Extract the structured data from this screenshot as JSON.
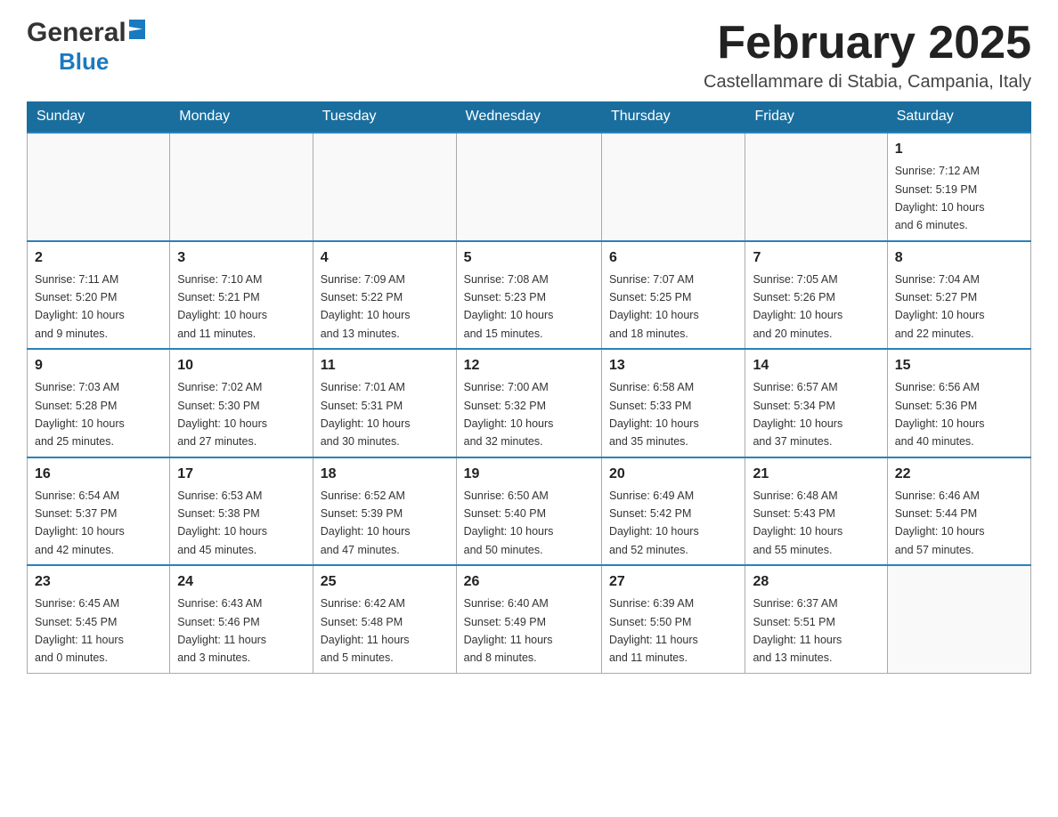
{
  "logo": {
    "general": "General",
    "blue": "Blue"
  },
  "header": {
    "month": "February 2025",
    "location": "Castellammare di Stabia, Campania, Italy"
  },
  "weekdays": [
    "Sunday",
    "Monday",
    "Tuesday",
    "Wednesday",
    "Thursday",
    "Friday",
    "Saturday"
  ],
  "weeks": [
    [
      {
        "day": "",
        "info": ""
      },
      {
        "day": "",
        "info": ""
      },
      {
        "day": "",
        "info": ""
      },
      {
        "day": "",
        "info": ""
      },
      {
        "day": "",
        "info": ""
      },
      {
        "day": "",
        "info": ""
      },
      {
        "day": "1",
        "info": "Sunrise: 7:12 AM\nSunset: 5:19 PM\nDaylight: 10 hours\nand 6 minutes."
      }
    ],
    [
      {
        "day": "2",
        "info": "Sunrise: 7:11 AM\nSunset: 5:20 PM\nDaylight: 10 hours\nand 9 minutes."
      },
      {
        "day": "3",
        "info": "Sunrise: 7:10 AM\nSunset: 5:21 PM\nDaylight: 10 hours\nand 11 minutes."
      },
      {
        "day": "4",
        "info": "Sunrise: 7:09 AM\nSunset: 5:22 PM\nDaylight: 10 hours\nand 13 minutes."
      },
      {
        "day": "5",
        "info": "Sunrise: 7:08 AM\nSunset: 5:23 PM\nDaylight: 10 hours\nand 15 minutes."
      },
      {
        "day": "6",
        "info": "Sunrise: 7:07 AM\nSunset: 5:25 PM\nDaylight: 10 hours\nand 18 minutes."
      },
      {
        "day": "7",
        "info": "Sunrise: 7:05 AM\nSunset: 5:26 PM\nDaylight: 10 hours\nand 20 minutes."
      },
      {
        "day": "8",
        "info": "Sunrise: 7:04 AM\nSunset: 5:27 PM\nDaylight: 10 hours\nand 22 minutes."
      }
    ],
    [
      {
        "day": "9",
        "info": "Sunrise: 7:03 AM\nSunset: 5:28 PM\nDaylight: 10 hours\nand 25 minutes."
      },
      {
        "day": "10",
        "info": "Sunrise: 7:02 AM\nSunset: 5:30 PM\nDaylight: 10 hours\nand 27 minutes."
      },
      {
        "day": "11",
        "info": "Sunrise: 7:01 AM\nSunset: 5:31 PM\nDaylight: 10 hours\nand 30 minutes."
      },
      {
        "day": "12",
        "info": "Sunrise: 7:00 AM\nSunset: 5:32 PM\nDaylight: 10 hours\nand 32 minutes."
      },
      {
        "day": "13",
        "info": "Sunrise: 6:58 AM\nSunset: 5:33 PM\nDaylight: 10 hours\nand 35 minutes."
      },
      {
        "day": "14",
        "info": "Sunrise: 6:57 AM\nSunset: 5:34 PM\nDaylight: 10 hours\nand 37 minutes."
      },
      {
        "day": "15",
        "info": "Sunrise: 6:56 AM\nSunset: 5:36 PM\nDaylight: 10 hours\nand 40 minutes."
      }
    ],
    [
      {
        "day": "16",
        "info": "Sunrise: 6:54 AM\nSunset: 5:37 PM\nDaylight: 10 hours\nand 42 minutes."
      },
      {
        "day": "17",
        "info": "Sunrise: 6:53 AM\nSunset: 5:38 PM\nDaylight: 10 hours\nand 45 minutes."
      },
      {
        "day": "18",
        "info": "Sunrise: 6:52 AM\nSunset: 5:39 PM\nDaylight: 10 hours\nand 47 minutes."
      },
      {
        "day": "19",
        "info": "Sunrise: 6:50 AM\nSunset: 5:40 PM\nDaylight: 10 hours\nand 50 minutes."
      },
      {
        "day": "20",
        "info": "Sunrise: 6:49 AM\nSunset: 5:42 PM\nDaylight: 10 hours\nand 52 minutes."
      },
      {
        "day": "21",
        "info": "Sunrise: 6:48 AM\nSunset: 5:43 PM\nDaylight: 10 hours\nand 55 minutes."
      },
      {
        "day": "22",
        "info": "Sunrise: 6:46 AM\nSunset: 5:44 PM\nDaylight: 10 hours\nand 57 minutes."
      }
    ],
    [
      {
        "day": "23",
        "info": "Sunrise: 6:45 AM\nSunset: 5:45 PM\nDaylight: 11 hours\nand 0 minutes."
      },
      {
        "day": "24",
        "info": "Sunrise: 6:43 AM\nSunset: 5:46 PM\nDaylight: 11 hours\nand 3 minutes."
      },
      {
        "day": "25",
        "info": "Sunrise: 6:42 AM\nSunset: 5:48 PM\nDaylight: 11 hours\nand 5 minutes."
      },
      {
        "day": "26",
        "info": "Sunrise: 6:40 AM\nSunset: 5:49 PM\nDaylight: 11 hours\nand 8 minutes."
      },
      {
        "day": "27",
        "info": "Sunrise: 6:39 AM\nSunset: 5:50 PM\nDaylight: 11 hours\nand 11 minutes."
      },
      {
        "day": "28",
        "info": "Sunrise: 6:37 AM\nSunset: 5:51 PM\nDaylight: 11 hours\nand 13 minutes."
      },
      {
        "day": "",
        "info": ""
      }
    ]
  ]
}
